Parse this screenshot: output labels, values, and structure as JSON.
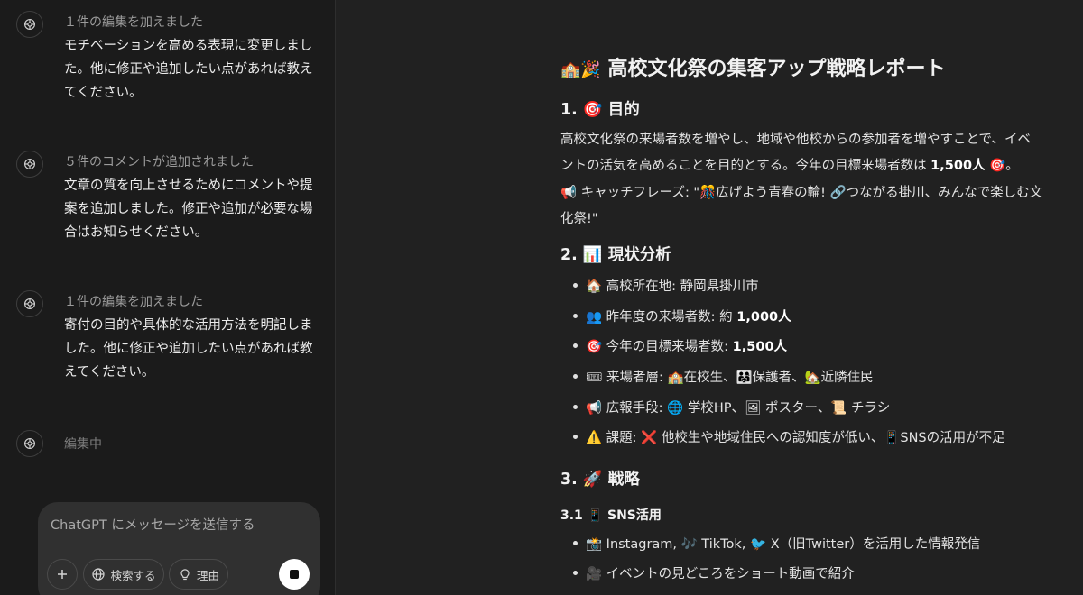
{
  "sidebar": {
    "messages": [
      {
        "status": "１件の編集を加えました",
        "lines": [
          "モチベーションを高める表現に変更しまし",
          "た。他に修正や追加したい点があれば教え",
          "てください。"
        ]
      },
      {
        "status": "５件のコメントが追加されました",
        "lines": [
          "文章の質を向上させるためにコメントや提",
          "案を追加しました。修正や追加が必要な場",
          "合はお知らせください。"
        ]
      },
      {
        "status": "１件の編集を加えました",
        "lines": [
          "寄付の目的や具体的な活用方法を明記しま",
          "した。他に修正や追加したい点があれば教",
          "えてください。"
        ]
      },
      {
        "status": "編集中",
        "lines": []
      }
    ]
  },
  "composer": {
    "placeholder": "ChatGPT にメッセージを送信する",
    "search_label": "検索する",
    "reason_label": "理由"
  },
  "doc": {
    "title_icons": "🏫🎉",
    "title": "高校文化祭の集客アップ戦略レポート",
    "s1": {
      "heading": "1. 🎯 目的",
      "para_a": "高校文化祭の来場者数を増やし、地域や他校からの参加者を増やすことで、イベ",
      "para_b": "ントの活気を高めることを目的とする。今年の目標来場者数は",
      "para_bold": "1,500人",
      "para_end": " 🎯。",
      "catch_a": "📢 キャッチフレーズ: \"🎊広げよう青春の輪! 🔗つながる掛川、みんなで楽しむ文",
      "catch_b": "化祭!\""
    },
    "s2": {
      "heading": "2. 📊 現状分析",
      "items": [
        {
          "pre": "🏠 高校所在地: 静岡県掛川市",
          "bold": ""
        },
        {
          "pre": "👥 昨年度の来場者数: 約 ",
          "bold": "1,000人"
        },
        {
          "pre": "🎯 今年の目標来場者数: ",
          "bold": "1,500人"
        },
        {
          "pre": "🎟 来場者層: 🏫在校生、👨‍👩‍👧保護者、🏡近隣住民",
          "bold": ""
        },
        {
          "pre": "📢 広報手段: 🌐 学校HP、🖼 ポスター、📜 チラシ",
          "bold": ""
        },
        {
          "pre": "⚠️ 課題: ❌ 他校生や地域住民への認知度が低い、📱SNSの活用が不足",
          "bold": ""
        }
      ]
    },
    "s3": {
      "heading": "3. 🚀 戦略",
      "sub": "3.1 📱 SNS活用",
      "items": [
        {
          "pre": "📸 Instagram, 🎶 TikTok, 🐦 X（旧Twitter）を活用した情報発信",
          "bold": ""
        },
        {
          "pre": "🎥 イベントの見どころをショート動画で紹介",
          "bold": ""
        }
      ]
    }
  }
}
